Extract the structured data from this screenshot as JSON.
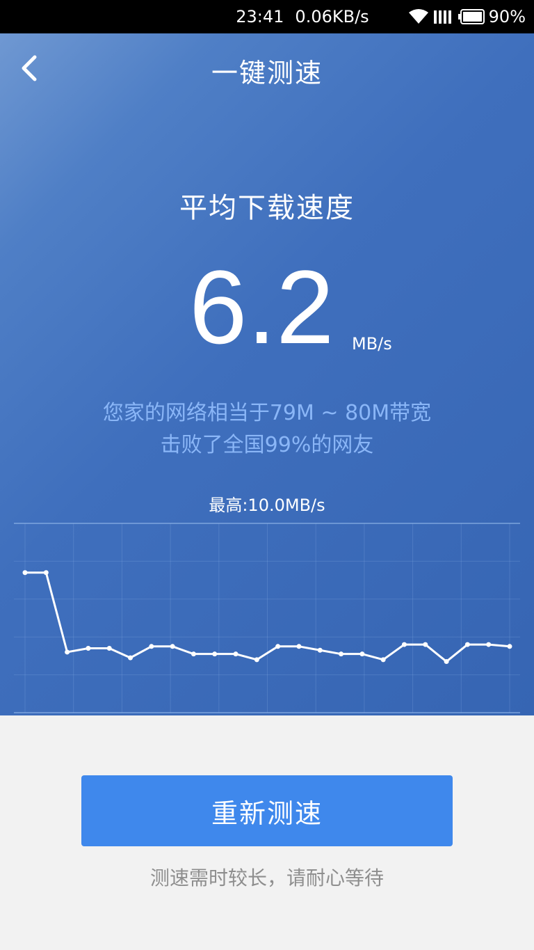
{
  "status_bar": {
    "time": "23:41",
    "net_speed": "0.06KB/s",
    "battery": "90%",
    "icons": [
      "wifi-icon",
      "signal-icon",
      "battery-icon"
    ]
  },
  "nav": {
    "back_icon": "chevron-left-icon",
    "title": "一键测速"
  },
  "result": {
    "label": "平均下载速度",
    "value": "6.2",
    "unit": "MB/s",
    "compare_line1": "您家的网络相当于79M ~ 80M带宽",
    "compare_line2": "击败了全国99%的网友",
    "max_label": "最高:10.0MB/s"
  },
  "chart_data": {
    "type": "line",
    "x": [
      1,
      2,
      3,
      4,
      5,
      6,
      7,
      8,
      9,
      10,
      11,
      12,
      13,
      14,
      15,
      16,
      17,
      18,
      19,
      20,
      21,
      22,
      23,
      24
    ],
    "values": [
      7.4,
      7.4,
      3.2,
      3.4,
      3.4,
      2.9,
      3.5,
      3.5,
      3.1,
      3.1,
      3.1,
      2.8,
      3.5,
      3.5,
      3.3,
      3.1,
      3.1,
      2.8,
      3.6,
      3.6,
      2.7,
      3.6,
      3.6,
      3.5
    ],
    "ylim": [
      0,
      10
    ],
    "grid": true,
    "title": "最高:10.0MB/s"
  },
  "colors": {
    "hero_bg": "#3665b3",
    "button": "#3f88ec",
    "compare_text": "#8ab6f7",
    "hint_text": "#8e8e8e"
  },
  "actions": {
    "retest_label": "重新测速",
    "hint": "测速需时较长，请耐心等待"
  }
}
